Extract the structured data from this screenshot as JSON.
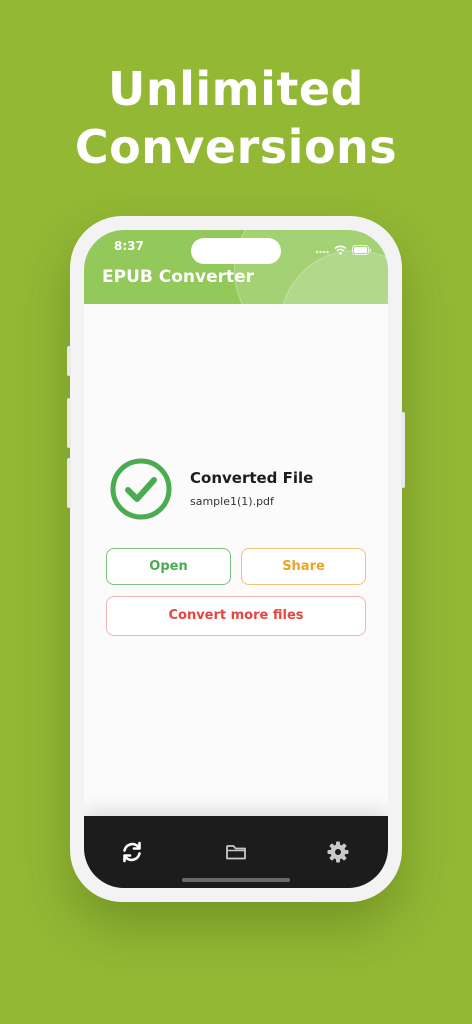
{
  "headline": {
    "line1": "Unlimited",
    "line2": "Conversions"
  },
  "status_bar": {
    "time": "8:37"
  },
  "app": {
    "title": "EPUB Converter"
  },
  "result": {
    "title": "Converted File",
    "file_name": "sample1(1).pdf",
    "icon": "check-circle-icon"
  },
  "actions": {
    "open_label": "Open",
    "share_label": "Share",
    "convert_more_label": "Convert more files"
  },
  "tab_bar": {
    "items": [
      {
        "icon": "refresh-icon",
        "active": true
      },
      {
        "icon": "folder-icon",
        "active": false
      },
      {
        "icon": "gear-icon",
        "active": false
      }
    ]
  },
  "colors": {
    "background": "#93b834",
    "header": "#93c95a",
    "success": "#4bab51",
    "share": "#f0a320",
    "convert": "#e8453f",
    "tab_bar": "#1c1c1c"
  }
}
